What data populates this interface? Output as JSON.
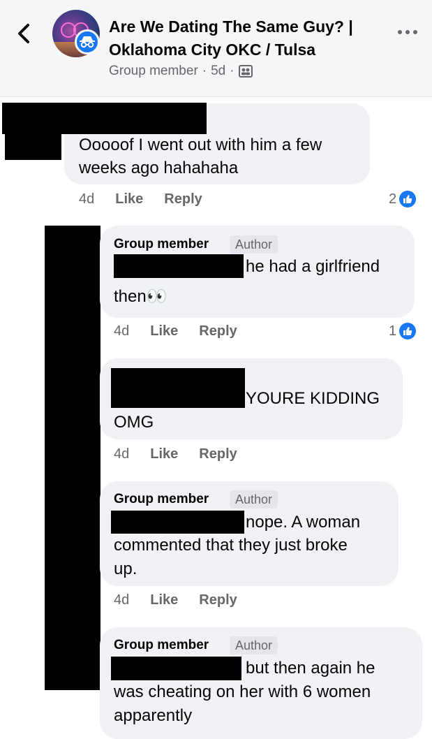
{
  "header": {
    "title": "Are We Dating The Same Guy? | Oklahoma City OKC / Tulsa",
    "meta_role": "Group member",
    "meta_time": "5d",
    "meta_sep": "·"
  },
  "comments": [
    {
      "text": "Ooooof I went out with him a few weeks ago hahahaha",
      "time": "4d",
      "like": "Like",
      "reply": "Reply",
      "reactions": "2"
    },
    {
      "name": "Group member",
      "badge": "Author",
      "text1": "he had a girlfriend",
      "text2": "then👀",
      "time": "4d",
      "like": "Like",
      "reply": "Reply",
      "reactions": "1"
    },
    {
      "text1": "YOURE KIDDING",
      "text2": "OMG",
      "time": "4d",
      "like": "Like",
      "reply": "Reply"
    },
    {
      "name": "Group member",
      "badge": "Author",
      "text1": "nope. A woman",
      "text2": "commented that they just broke",
      "text3": "up.",
      "time": "4d",
      "like": "Like",
      "reply": "Reply"
    },
    {
      "name": "Group member",
      "badge": "Author",
      "text1": "but then again he",
      "text2": "was cheating on her with 6 women",
      "text3": "apparently"
    }
  ]
}
